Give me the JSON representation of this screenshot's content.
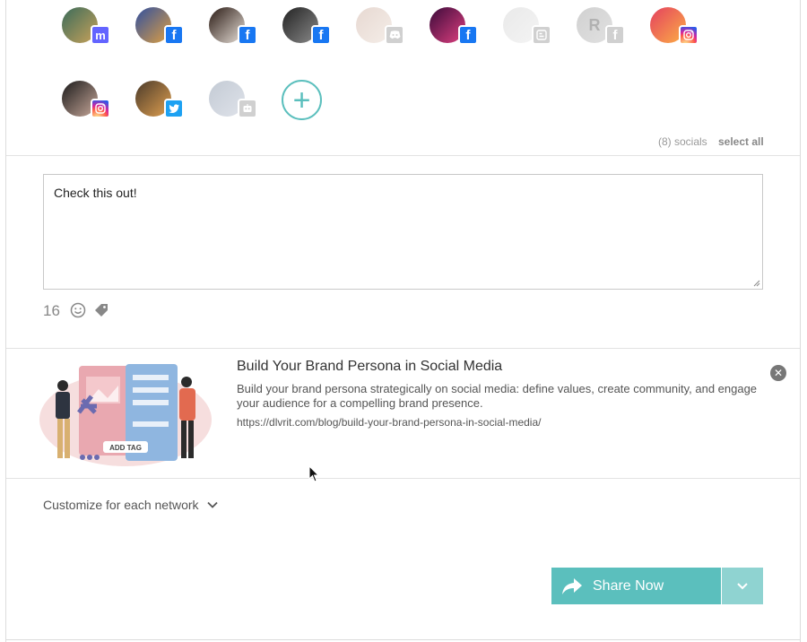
{
  "socials": {
    "accounts": [
      {
        "network": "mastodon",
        "icon": "mastodon-icon",
        "badge_text": "m",
        "active": true,
        "colors": [
          "#3a6b5a",
          "#c9a25a"
        ]
      },
      {
        "network": "facebook",
        "icon": "facebook-icon",
        "badge_text": "f",
        "active": true,
        "colors": [
          "#3050a0",
          "#e0a040"
        ]
      },
      {
        "network": "facebook",
        "icon": "facebook-icon",
        "badge_text": "f",
        "active": true,
        "colors": [
          "#2a1a14",
          "#e8e0d8"
        ]
      },
      {
        "network": "facebook",
        "icon": "facebook-icon",
        "badge_text": "f",
        "active": true,
        "colors": [
          "#222",
          "#8a8a8a"
        ]
      },
      {
        "network": "discord",
        "icon": "discord-icon",
        "badge_text": "",
        "active": false,
        "colors": [
          "#c9a99a",
          "#e8d8cc"
        ]
      },
      {
        "network": "facebook",
        "icon": "facebook-icon",
        "badge_text": "f",
        "active": true,
        "colors": [
          "#3a0a3a",
          "#e04080"
        ]
      },
      {
        "network": "blogger",
        "icon": "blogger-icon",
        "badge_text": "",
        "active": false,
        "colors": [
          "#cfcfcf",
          "#e6e6e6"
        ]
      },
      {
        "network": "facebook",
        "icon": "facebook-icon",
        "badge_text": "f",
        "active": false,
        "avatar_letter": "R",
        "colors": [
          "#9a9a9a",
          "#bdbdbd"
        ]
      },
      {
        "network": "instagram",
        "icon": "instagram-icon",
        "badge_text": "",
        "active": true,
        "colors": [
          "#e4405f",
          "#fcaf45"
        ]
      },
      {
        "network": "instagram",
        "icon": "instagram-icon",
        "badge_text": "",
        "active": true,
        "colors": [
          "#1a1a1a",
          "#c8a89a"
        ]
      },
      {
        "network": "twitter",
        "icon": "twitter-icon",
        "badge_text": "",
        "active": true,
        "colors": [
          "#4a3a2a",
          "#e0a050"
        ]
      },
      {
        "network": "robot",
        "icon": "robot-icon",
        "badge_text": "",
        "active": false,
        "colors": [
          "#7a8aa0",
          "#b8c0d0"
        ]
      }
    ],
    "count_label": "(8) socials",
    "select_all_label": "select all"
  },
  "composer": {
    "text": "Check this out!",
    "char_count": "16"
  },
  "link_preview": {
    "title": "Build Your Brand Persona in Social Media",
    "description": "Build your brand persona strategically on social media: define values, create community, and engage your audience for a compelling brand presence.",
    "url": "https://dlvrit.com/blog/build-your-brand-persona-in-social-media/",
    "image_tag_text": "ADD TAG"
  },
  "customize_label": "Customize for each network",
  "share": {
    "label": "Share Now"
  },
  "colors": {
    "accent": "#5bbfbd",
    "accent_light": "#8fd3d1"
  }
}
